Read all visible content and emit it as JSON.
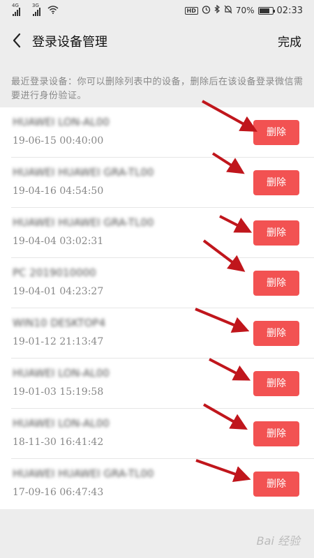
{
  "status_bar": {
    "signal1": "4G",
    "signal2": "3G",
    "hd": "HD",
    "battery": "70%",
    "time": "02:33"
  },
  "header": {
    "title": "登录设备管理",
    "done_label": "完成"
  },
  "tip": "最近登录设备：你可以删除列表中的设备，删除后在该设备登录微信需要进行身份验证。",
  "devices": [
    {
      "name": "HUAWEI LON-AL00",
      "time": "19-06-15 00:40:00",
      "delete_label": "删除"
    },
    {
      "name": "HUAWEI HUAWEI GRA-TL00",
      "time": "19-04-16 04:54:50",
      "delete_label": "删除"
    },
    {
      "name": "HUAWEI HUAWEI GRA-TL00",
      "time": "19-04-04 03:02:31",
      "delete_label": "删除"
    },
    {
      "name": "PC 2019010000",
      "time": "19-04-01 04:23:27",
      "delete_label": "删除"
    },
    {
      "name": "WIN10 DESKTOP4",
      "time": "19-01-12 21:13:47",
      "delete_label": "删除"
    },
    {
      "name": "HUAWEI LON-AL00",
      "time": "19-01-03 15:19:58",
      "delete_label": "删除"
    },
    {
      "name": "HUAWEI LON-AL00",
      "time": "18-11-30 16:41:42",
      "delete_label": "删除"
    },
    {
      "name": "HUAWEI HUAWEI GRA-TL00",
      "time": "17-09-16 06:47:43",
      "delete_label": "删除"
    }
  ],
  "watermark": "Bai 经验",
  "colors": {
    "delete_button": "#f25252",
    "arrow": "#c0161c",
    "background": "#ededed"
  }
}
